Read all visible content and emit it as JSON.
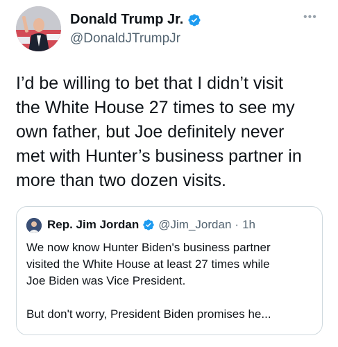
{
  "tweet": {
    "author": {
      "name": "Donald Trump Jr.",
      "handle": "@DonaldJTrumpJr",
      "verified_color": "#1d9bf0"
    },
    "more_icon": "more-horizontal-icon",
    "text": "I’d be willing to bet that I didn’t visit\nthe White House 27 times to see my\nown father, but Joe definitely never\nmet with Hunter’s business partner in\nmore than two dozen visits."
  },
  "quote": {
    "author": {
      "name": "Rep. Jim Jordan",
      "handle": "@Jim_Jordan",
      "separator": "·",
      "time": "1h"
    },
    "text": "We now know Hunter Biden's business partner\nvisited the White House at least 27 times while\nJoe Biden was Vice President.\n\nBut don't worry, President Biden promises he..."
  }
}
